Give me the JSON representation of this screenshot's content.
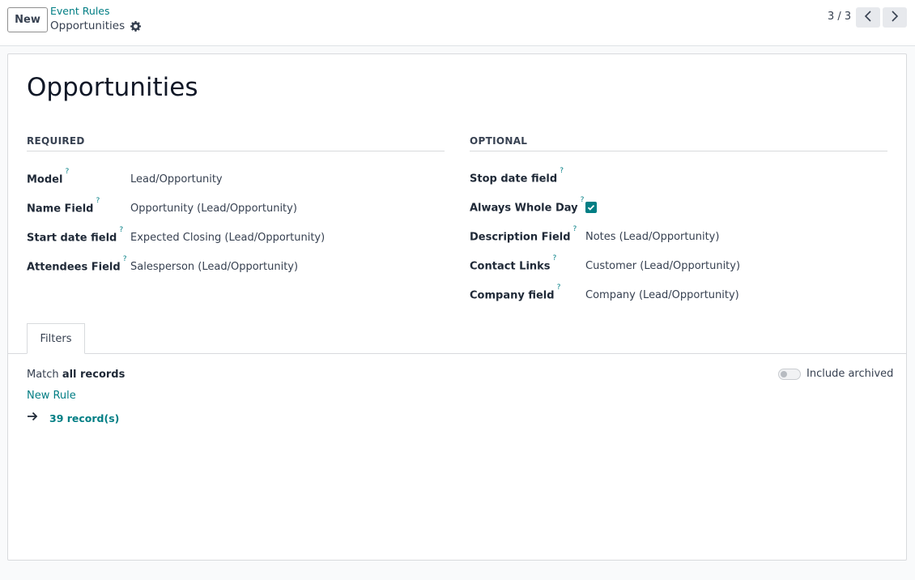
{
  "control_panel": {
    "new_button": "New",
    "breadcrumb_parent": "Event Rules",
    "breadcrumb_current": "Opportunities",
    "pager_value": "3 / 3"
  },
  "form": {
    "title": "Opportunities",
    "required": {
      "header": "REQUIRED",
      "fields": [
        {
          "label": "Model",
          "help": "?",
          "value": "Lead/Opportunity"
        },
        {
          "label": "Name Field",
          "help": "?",
          "value": "Opportunity (Lead/Opportunity)"
        },
        {
          "label": "Start date field",
          "help": "?",
          "value": "Expected Closing (Lead/Opportunity)"
        },
        {
          "label": "Attendees Field",
          "help": "?",
          "value": "Salesperson (Lead/Opportunity)"
        }
      ]
    },
    "optional": {
      "header": "OPTIONAL",
      "fields": [
        {
          "label": "Stop date field",
          "help": "?",
          "value": ""
        },
        {
          "label": "Always Whole Day",
          "help": "?",
          "value": "",
          "checked": true
        },
        {
          "label": "Description Field",
          "help": "?",
          "value": "Notes (Lead/Opportunity)"
        },
        {
          "label": "Contact Links",
          "help": "?",
          "value": "Customer (Lead/Opportunity)"
        },
        {
          "label": "Company field",
          "help": "?",
          "value": "Company (Lead/Opportunity)"
        }
      ]
    },
    "tabs": [
      {
        "label": "Filters"
      }
    ],
    "filters": {
      "match_prefix": "Match",
      "match_value": "all records",
      "new_rule": "New Rule",
      "records": "39 record(s)",
      "include_archived": "Include archived",
      "include_archived_on": false
    }
  },
  "colors": {
    "accent": "#017e84",
    "text": "#374151",
    "border": "#d8dadd"
  }
}
